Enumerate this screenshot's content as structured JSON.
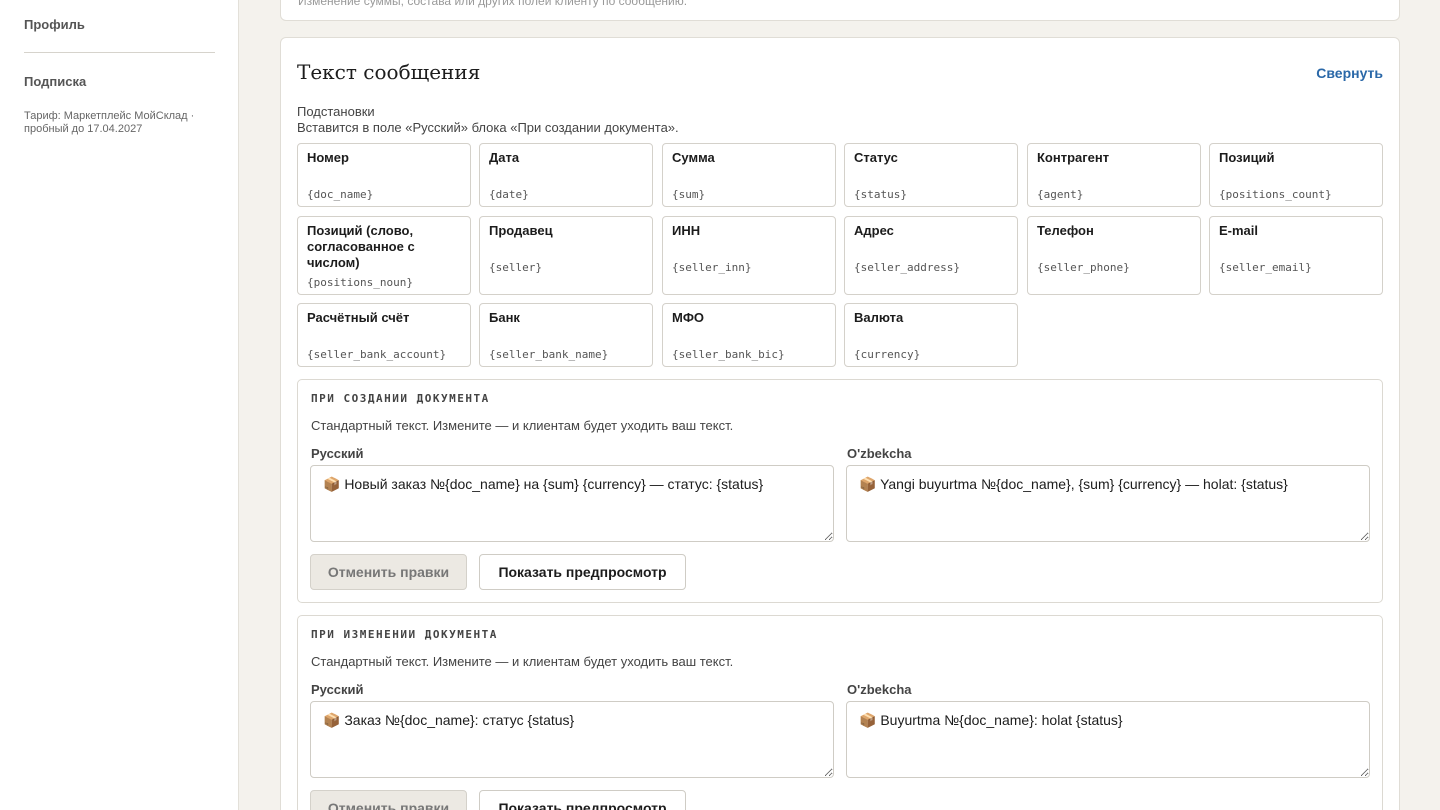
{
  "sidebar": {
    "profile": "Профиль",
    "subscription": "Подписка",
    "tariff": "Тариф: Маркетплейс МойСклад · пробный до 17.04.2027"
  },
  "top_card_text": "Изменение суммы, состава или других полей клиенту по сообщению.",
  "message_card": {
    "title": "Текст сообщения",
    "collapse": "Свернуть",
    "subs_title": "Подстановки",
    "subs_hint": "Вставится в поле «Русский» блока «При создании документа».",
    "chips": [
      {
        "label": "Номер",
        "code": "{doc_name}"
      },
      {
        "label": "Дата",
        "code": "{date}"
      },
      {
        "label": "Сумма",
        "code": "{sum}"
      },
      {
        "label": "Статус",
        "code": "{status}"
      },
      {
        "label": "Контрагент",
        "code": "{agent}"
      },
      {
        "label": "Позиций",
        "code": "{positions_count}"
      },
      {
        "label": "Позиций (слово, согласованное с числом)",
        "code": "{positions_noun}"
      },
      {
        "label": "Продавец",
        "code": "{seller}"
      },
      {
        "label": "ИНН",
        "code": "{seller_inn}"
      },
      {
        "label": "Адрес",
        "code": "{seller_address}"
      },
      {
        "label": "Телефон",
        "code": "{seller_phone}"
      },
      {
        "label": "E-mail",
        "code": "{seller_email}"
      },
      {
        "label": "Расчётный счёт",
        "code": "{seller_bank_account}"
      },
      {
        "label": "Банк",
        "code": "{seller_bank_name}"
      },
      {
        "label": "МФО",
        "code": "{seller_bank_bic}"
      },
      {
        "label": "Валюта",
        "code": "{currency}"
      }
    ],
    "sections": [
      {
        "heading": "ПРИ СОЗДАНИИ ДОКУМЕНТА",
        "note": "Стандартный текст. Измените — и клиентам будет уходить ваш текст.",
        "ru_label": "Русский",
        "uz_label": "O'zbekcha",
        "ru_text": "📦 Новый заказ №{doc_name} на {sum} {currency} — статус: {status}",
        "uz_text": "📦 Yangi buyurtma №{doc_name}, {sum} {currency} — holat: {status}",
        "reset": "Отменить правки",
        "preview": "Показать предпросмотр"
      },
      {
        "heading": "ПРИ ИЗМЕНЕНИИ ДОКУМЕНТА",
        "note": "Стандартный текст. Измените — и клиентам будет уходить ваш текст.",
        "ru_label": "Русский",
        "uz_label": "O'zbekcha",
        "ru_text": "📦 Заказ №{doc_name}: статус {status}",
        "uz_text": "📦 Buyurtma №{doc_name}: holat {status}",
        "reset": "Отменить правки",
        "preview": "Показать предпросмотр"
      }
    ]
  }
}
